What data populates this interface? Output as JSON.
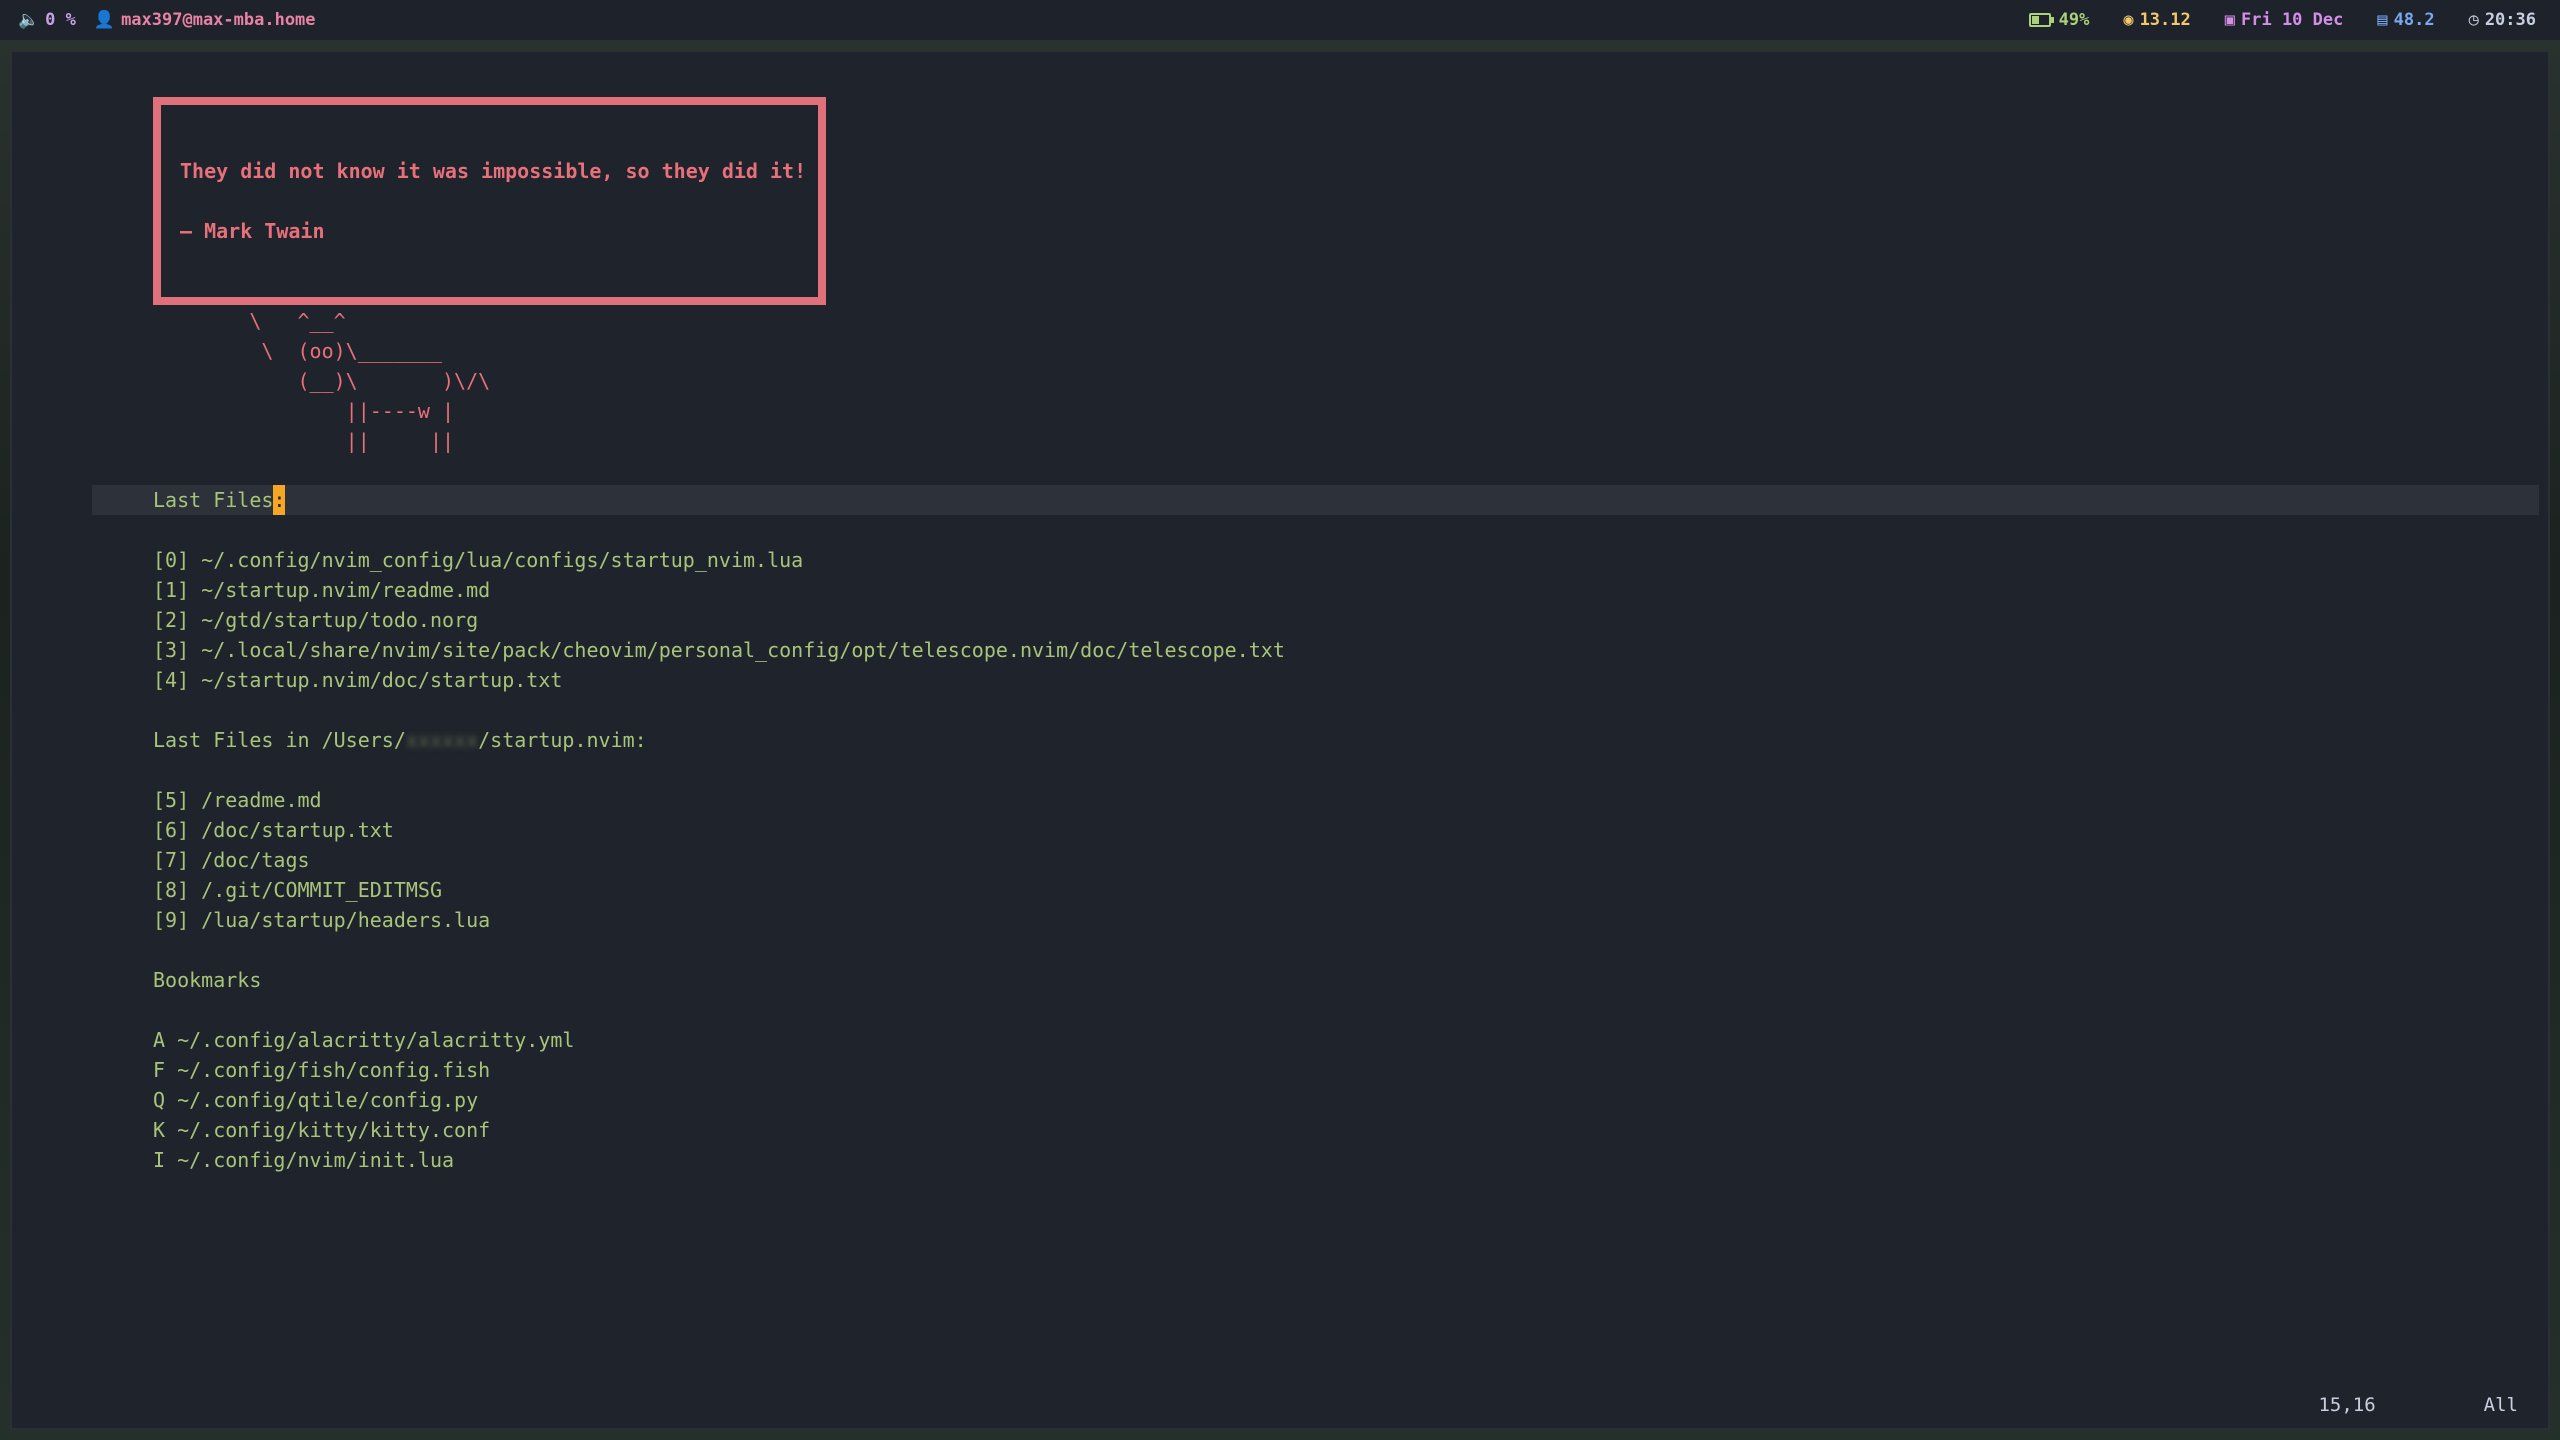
{
  "topbar": {
    "volume_value": "0 %",
    "user_host": "max397@max-mba.home",
    "battery": "49%",
    "cpu": "13.12",
    "date": "Fri 10 Dec",
    "memory": "48.2",
    "clock": "20:36"
  },
  "quote": {
    "text": "They did not know it was impossible, so they did it!",
    "author": "— Mark Twain"
  },
  "cowsay": [
    "        \\   ^__^",
    "         \\  (oo)\\_______",
    "            (__)\\       )\\/\\",
    "                ||----w |",
    "                ||     ||"
  ],
  "last_files": {
    "header": "Last Files",
    "header_suffix": ":",
    "items": [
      "[0] ~/.config/nvim_config/lua/configs/startup_nvim.lua",
      "[1] ~/startup.nvim/readme.md",
      "[2] ~/gtd/startup/todo.norg",
      "[3] ~/.local/share/nvim/site/pack/cheovim/personal_config/opt/telescope.nvim/doc/telescope.txt",
      "[4] ~/startup.nvim/doc/startup.txt"
    ]
  },
  "last_files_dir": {
    "header_prefix": "Last Files in /Users/",
    "header_blurred": "xxxxxx",
    "header_suffix": "/startup.nvim:",
    "items": [
      "[5] /readme.md",
      "[6] /doc/startup.txt",
      "[7] /doc/tags",
      "[8] /.git/COMMIT_EDITMSG",
      "[9] /lua/startup/headers.lua"
    ]
  },
  "bookmarks": {
    "header": "Bookmarks",
    "items": [
      "A ~/.config/alacritty/alacritty.yml",
      "F ~/.config/fish/config.fish",
      "Q ~/.config/qtile/config.py",
      "K ~/.config/kitty/kitty.conf",
      "I ~/.config/nvim/init.lua"
    ]
  },
  "statusline": {
    "position": "15,16",
    "scroll": "All"
  }
}
